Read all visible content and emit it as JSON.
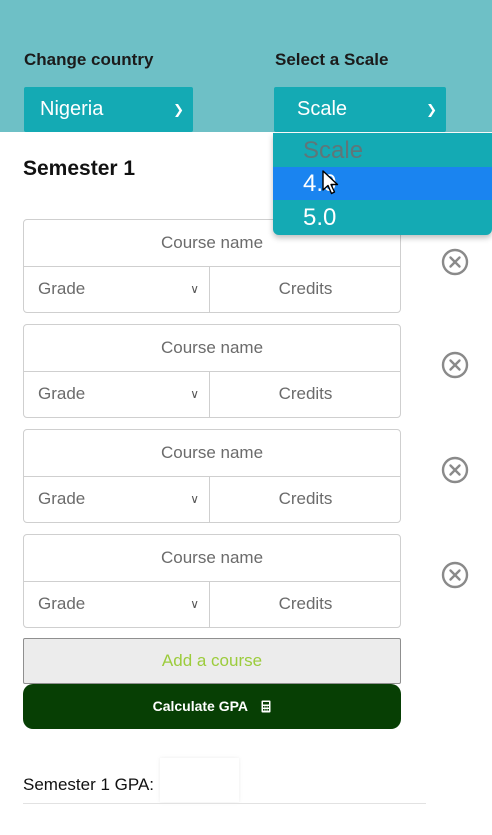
{
  "country": {
    "label": "Change country",
    "selected": "Nigeria"
  },
  "scale": {
    "label": "Select a Scale",
    "selected": "Scale",
    "options": [
      "Scale",
      "4.0",
      "5.0"
    ],
    "highlighted": "4.0"
  },
  "semester": {
    "title": "Semester 1",
    "courses": [
      {
        "name_placeholder": "Course name",
        "grade_placeholder": "Grade",
        "credits_placeholder": "Credits"
      },
      {
        "name_placeholder": "Course name",
        "grade_placeholder": "Grade",
        "credits_placeholder": "Credits"
      },
      {
        "name_placeholder": "Course name",
        "grade_placeholder": "Grade",
        "credits_placeholder": "Credits"
      },
      {
        "name_placeholder": "Course name",
        "grade_placeholder": "Grade",
        "credits_placeholder": "Credits"
      }
    ],
    "add_course_label": "Add a course",
    "calculate_label": "Calculate GPA",
    "gpa_label": "Semester 1 GPA:",
    "gpa_value": ""
  },
  "colors": {
    "header_band": "#6ec0c6",
    "select_teal": "#14aab4",
    "option_highlight": "#1a84f0",
    "calc_button": "#073f04",
    "add_course_text": "#9ccc3c"
  },
  "icons": {
    "remove": "close-circle-icon",
    "calculator": "calculator-icon",
    "chevron": "chevron-down-icon",
    "cursor": "mouse-pointer-icon"
  }
}
